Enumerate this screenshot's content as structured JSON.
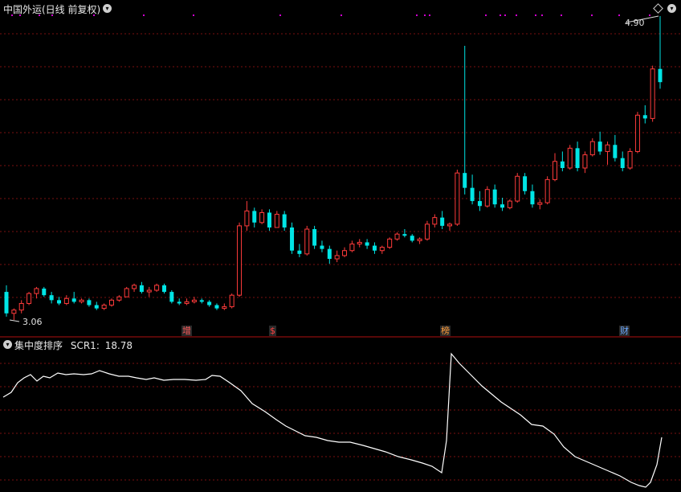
{
  "upper_panel": {
    "title": "中国外运(日线 前复权)",
    "max_label": "4.90",
    "min_label": "3.06",
    "badges": [
      {
        "text": "增",
        "color": "#ff5a5a"
      },
      {
        "text": "$",
        "color": "#ff4040"
      },
      {
        "text": "榜",
        "color": "#ff9c3a"
      },
      {
        "text": "财",
        "color": "#6aa8ff"
      }
    ],
    "colors": {
      "up": "#ff3b3b",
      "down": "#00e5e5",
      "grid": "#7a1010",
      "marker": "#d000d0"
    }
  },
  "lower_panel": {
    "indicator_name": "集中度排序",
    "scr_label": "SCR1:",
    "scr_value": "18.78",
    "line_color": "#ffffff"
  },
  "icons": {
    "menu": "chevron-down-icon",
    "settings": "diamond-icon"
  },
  "chart_data": {
    "type": "candlestick",
    "price_range": [
      3.06,
      4.9
    ],
    "candles": [
      [
        3.23,
        3.27,
        3.08,
        3.1
      ],
      [
        3.1,
        3.13,
        3.06,
        3.12
      ],
      [
        3.12,
        3.18,
        3.1,
        3.16
      ],
      [
        3.16,
        3.23,
        3.15,
        3.22
      ],
      [
        3.22,
        3.26,
        3.19,
        3.25
      ],
      [
        3.25,
        3.26,
        3.2,
        3.21
      ],
      [
        3.21,
        3.23,
        3.16,
        3.18
      ],
      [
        3.18,
        3.2,
        3.15,
        3.16
      ],
      [
        3.16,
        3.21,
        3.15,
        3.19
      ],
      [
        3.19,
        3.23,
        3.16,
        3.17
      ],
      [
        3.17,
        3.19,
        3.16,
        3.18
      ],
      [
        3.18,
        3.19,
        3.14,
        3.15
      ],
      [
        3.15,
        3.17,
        3.12,
        3.13
      ],
      [
        3.13,
        3.16,
        3.12,
        3.15
      ],
      [
        3.15,
        3.19,
        3.14,
        3.18
      ],
      [
        3.18,
        3.21,
        3.17,
        3.2
      ],
      [
        3.2,
        3.26,
        3.2,
        3.25
      ],
      [
        3.25,
        3.28,
        3.23,
        3.27
      ],
      [
        3.27,
        3.29,
        3.22,
        3.23
      ],
      [
        3.23,
        3.26,
        3.2,
        3.24
      ],
      [
        3.24,
        3.28,
        3.23,
        3.27
      ],
      [
        3.27,
        3.28,
        3.22,
        3.23
      ],
      [
        3.23,
        3.24,
        3.16,
        3.17
      ],
      [
        3.17,
        3.19,
        3.15,
        3.16
      ],
      [
        3.16,
        3.19,
        3.15,
        3.17
      ],
      [
        3.17,
        3.2,
        3.16,
        3.18
      ],
      [
        3.18,
        3.19,
        3.16,
        3.17
      ],
      [
        3.17,
        3.18,
        3.14,
        3.15
      ],
      [
        3.15,
        3.16,
        3.12,
        3.13
      ],
      [
        3.13,
        3.16,
        3.12,
        3.14
      ],
      [
        3.14,
        3.22,
        3.13,
        3.21
      ],
      [
        3.21,
        3.65,
        3.2,
        3.63
      ],
      [
        3.63,
        3.78,
        3.6,
        3.72
      ],
      [
        3.72,
        3.74,
        3.62,
        3.65
      ],
      [
        3.65,
        3.73,
        3.64,
        3.71
      ],
      [
        3.71,
        3.73,
        3.6,
        3.62
      ],
      [
        3.62,
        3.72,
        3.62,
        3.7
      ],
      [
        3.7,
        3.72,
        3.6,
        3.62
      ],
      [
        3.62,
        3.65,
        3.46,
        3.48
      ],
      [
        3.48,
        3.52,
        3.44,
        3.46
      ],
      [
        3.46,
        3.63,
        3.45,
        3.61
      ],
      [
        3.61,
        3.63,
        3.49,
        3.51
      ],
      [
        3.51,
        3.54,
        3.47,
        3.49
      ],
      [
        3.49,
        3.51,
        3.4,
        3.43
      ],
      [
        3.43,
        3.48,
        3.41,
        3.45
      ],
      [
        3.45,
        3.5,
        3.44,
        3.48
      ],
      [
        3.48,
        3.54,
        3.47,
        3.52
      ],
      [
        3.52,
        3.55,
        3.5,
        3.53
      ],
      [
        3.53,
        3.55,
        3.49,
        3.51
      ],
      [
        3.51,
        3.53,
        3.46,
        3.48
      ],
      [
        3.48,
        3.51,
        3.46,
        3.5
      ],
      [
        3.5,
        3.56,
        3.49,
        3.55
      ],
      [
        3.55,
        3.59,
        3.54,
        3.58
      ],
      [
        3.58,
        3.61,
        3.56,
        3.57
      ],
      [
        3.57,
        3.58,
        3.53,
        3.54
      ],
      [
        3.54,
        3.56,
        3.52,
        3.55
      ],
      [
        3.55,
        3.66,
        3.54,
        3.64
      ],
      [
        3.64,
        3.7,
        3.62,
        3.68
      ],
      [
        3.68,
        3.72,
        3.61,
        3.63
      ],
      [
        3.63,
        3.65,
        3.6,
        3.64
      ],
      [
        3.64,
        3.97,
        3.63,
        3.95
      ],
      [
        3.95,
        4.72,
        3.82,
        3.86
      ],
      [
        3.86,
        3.94,
        3.76,
        3.78
      ],
      [
        3.78,
        3.84,
        3.72,
        3.75
      ],
      [
        3.75,
        3.87,
        3.74,
        3.85
      ],
      [
        3.85,
        3.88,
        3.74,
        3.76
      ],
      [
        3.76,
        3.8,
        3.72,
        3.74
      ],
      [
        3.74,
        3.79,
        3.73,
        3.78
      ],
      [
        3.78,
        3.95,
        3.77,
        3.93
      ],
      [
        3.93,
        3.95,
        3.82,
        3.84
      ],
      [
        3.84,
        3.88,
        3.74,
        3.76
      ],
      [
        3.76,
        3.79,
        3.73,
        3.77
      ],
      [
        3.77,
        3.93,
        3.76,
        3.91
      ],
      [
        3.91,
        4.07,
        3.9,
        4.02
      ],
      [
        4.02,
        4.08,
        3.96,
        3.98
      ],
      [
        3.98,
        4.12,
        3.97,
        4.1
      ],
      [
        4.1,
        4.14,
        3.96,
        3.98
      ],
      [
        3.98,
        4.08,
        3.95,
        4.06
      ],
      [
        4.06,
        4.16,
        4.05,
        4.14
      ],
      [
        4.14,
        4.2,
        4.06,
        4.08
      ],
      [
        4.08,
        4.14,
        4.0,
        4.12
      ],
      [
        4.12,
        4.18,
        4.02,
        4.04
      ],
      [
        4.04,
        4.08,
        3.96,
        3.98
      ],
      [
        3.98,
        4.1,
        3.97,
        4.08
      ],
      [
        4.08,
        4.32,
        4.07,
        4.3
      ],
      [
        4.3,
        4.36,
        4.25,
        4.28
      ],
      [
        4.28,
        4.6,
        4.26,
        4.58
      ],
      [
        4.58,
        4.9,
        4.46,
        4.5
      ]
    ]
  }
}
